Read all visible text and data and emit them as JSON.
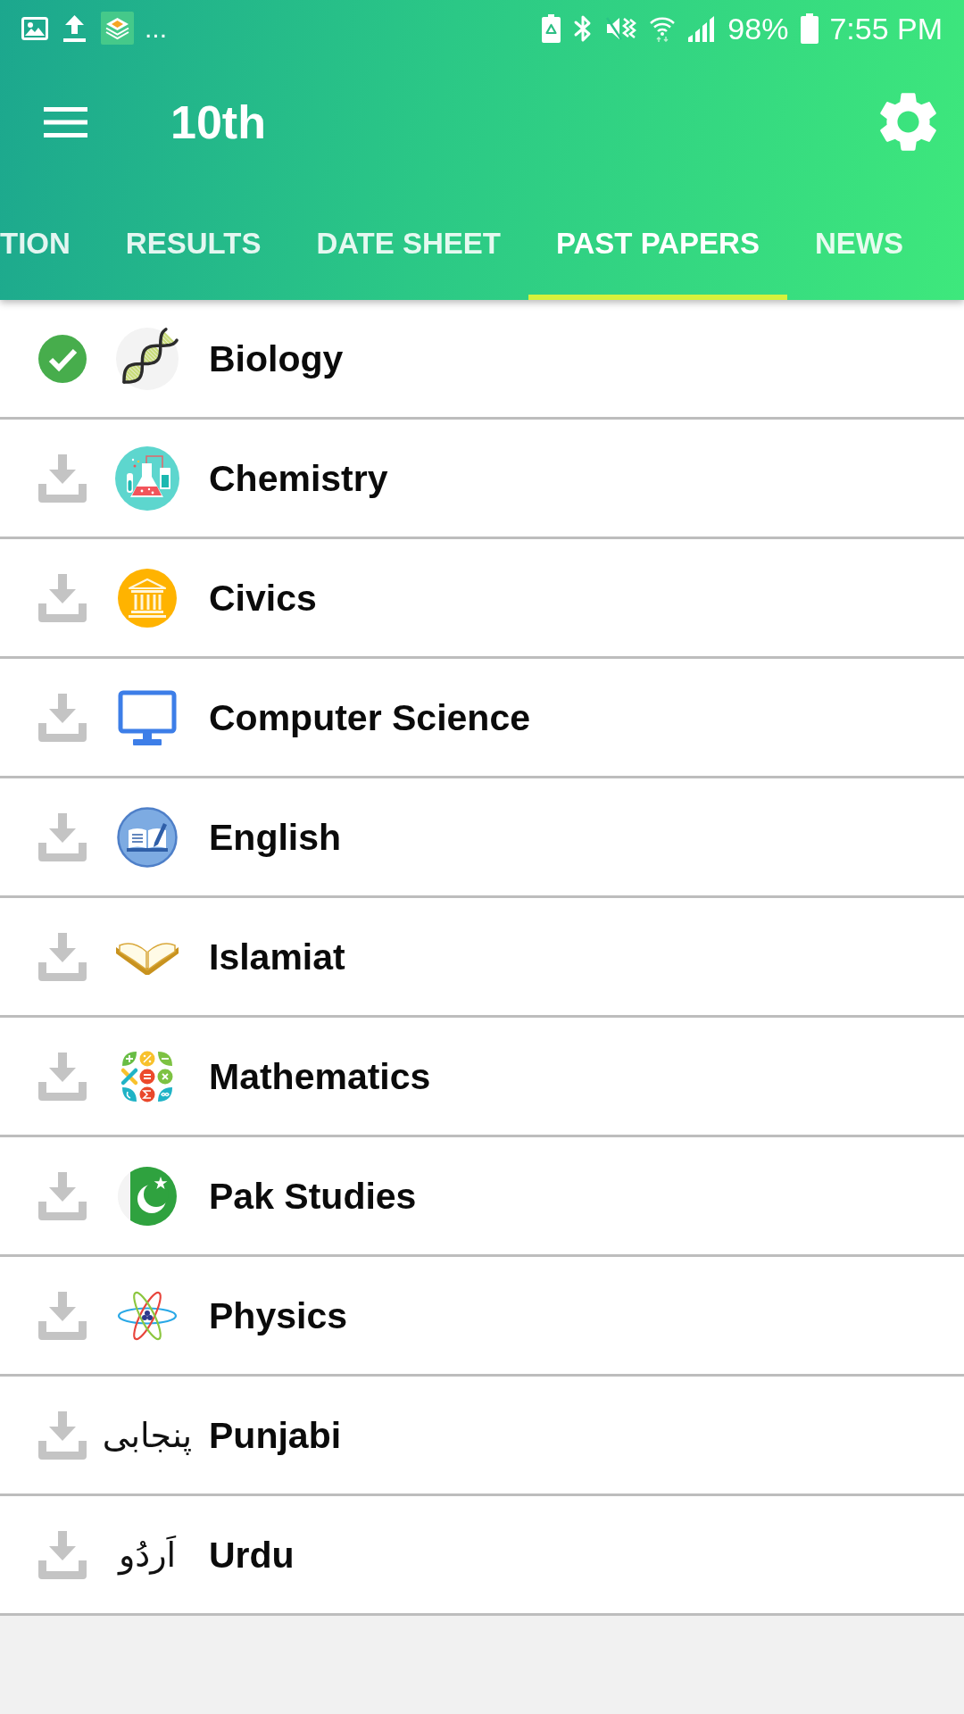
{
  "status_bar": {
    "more_notifications": "...",
    "battery_level": "98%",
    "time": "7:55 PM"
  },
  "toolbar": {
    "title": "10th"
  },
  "tabs": [
    {
      "label": "TION",
      "selected": false
    },
    {
      "label": "RESULTS",
      "selected": false
    },
    {
      "label": "DATE SHEET",
      "selected": false
    },
    {
      "label": "PAST PAPERS",
      "selected": true
    },
    {
      "label": "NEWS",
      "selected": false
    }
  ],
  "subjects": [
    {
      "name": "Biology",
      "downloaded": true
    },
    {
      "name": "Chemistry",
      "downloaded": false
    },
    {
      "name": "Civics",
      "downloaded": false
    },
    {
      "name": "Computer Science",
      "downloaded": false
    },
    {
      "name": "English",
      "downloaded": false
    },
    {
      "name": "Islamiat",
      "downloaded": false
    },
    {
      "name": "Mathematics",
      "downloaded": false
    },
    {
      "name": "Pak Studies",
      "downloaded": false
    },
    {
      "name": "Physics",
      "downloaded": false
    },
    {
      "name": "Punjabi",
      "downloaded": false,
      "icon_text": "پنجابی"
    },
    {
      "name": "Urdu",
      "downloaded": false,
      "icon_text": "اَردُو"
    }
  ]
}
